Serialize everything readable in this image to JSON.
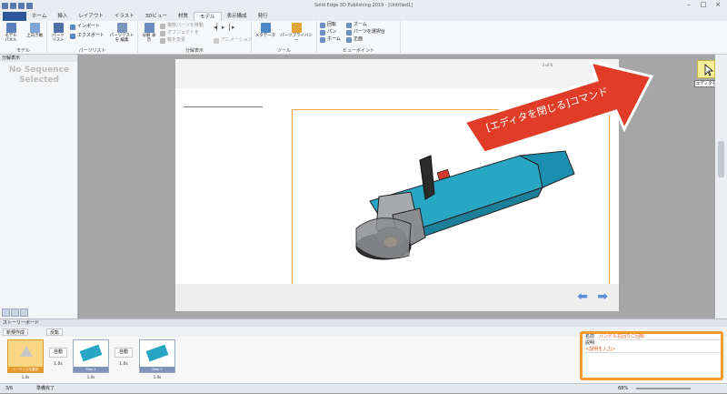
{
  "window": {
    "title": "Solid Edge 3D Publishing 2019 - [Untitled1]"
  },
  "tabs": [
    "ホーム",
    "挿入",
    "レイアウト",
    "イラスト",
    "3Dビュー",
    "材質",
    "モデル",
    "表示構成",
    "発行"
  ],
  "active_tab": "モデル",
  "ribbon": {
    "groups": [
      {
        "label": "モデル",
        "buttons": [
          "モデル パネル",
          "上向き軸"
        ]
      },
      {
        "label": "パーツリスト",
        "buttons": [
          "パーツ リスト",
          "インポート",
          "エクスポート",
          "パーツリストを 編集"
        ]
      },
      {
        "label": "分解表示",
        "buttons": [
          "分解 表示",
          "複数パーツを移動",
          "オブジェクトを",
          "軸を変更",
          "アニメーション"
        ]
      },
      {
        "label": "ツール",
        "buttons": [
          "メタデータ",
          "パーツプライバシー"
        ]
      },
      {
        "label": "ビューポイント",
        "buttons": [
          "回転",
          "パン",
          "ホーム",
          "ズーム",
          "パーツを選択台",
          "正面"
        ]
      }
    ]
  },
  "left_panel": {
    "title": "分解表示",
    "empty_text": "No Sequence Selected"
  },
  "page": {
    "page_number": "3 of 6"
  },
  "callout": {
    "text": "[エディタを閉じる]コマンド",
    "fill": "#e03c28",
    "border": "#ffffff"
  },
  "editor_button": {
    "tooltip": "エディタを閉じる"
  },
  "storyboard": {
    "title": "ストーリーボード",
    "toolbar": [
      "新規作成",
      "反転"
    ],
    "items": [
      {
        "kind": "thumb",
        "caption": "シーケンス未選択",
        "time": "1.0s"
      },
      {
        "kind": "transition",
        "label": "自動",
        "time": "1.0s"
      },
      {
        "kind": "thumb",
        "caption": "Step 1",
        "time": "1.0s"
      },
      {
        "kind": "transition",
        "label": "自動",
        "time": "1.0s"
      },
      {
        "kind": "thumb",
        "caption": "Step 2",
        "time": "1.0s"
      }
    ]
  },
  "properties": {
    "name_label": "名前",
    "name_value": "ハンドル右回りに回転",
    "desc_label": "説明",
    "desc_value": "<説明を入力>"
  },
  "status": {
    "page": "3/6",
    "ready": "準備完了",
    "zoom": "68%"
  },
  "colors": {
    "accent": "#2b579a",
    "highlight": "#f29a2e"
  }
}
